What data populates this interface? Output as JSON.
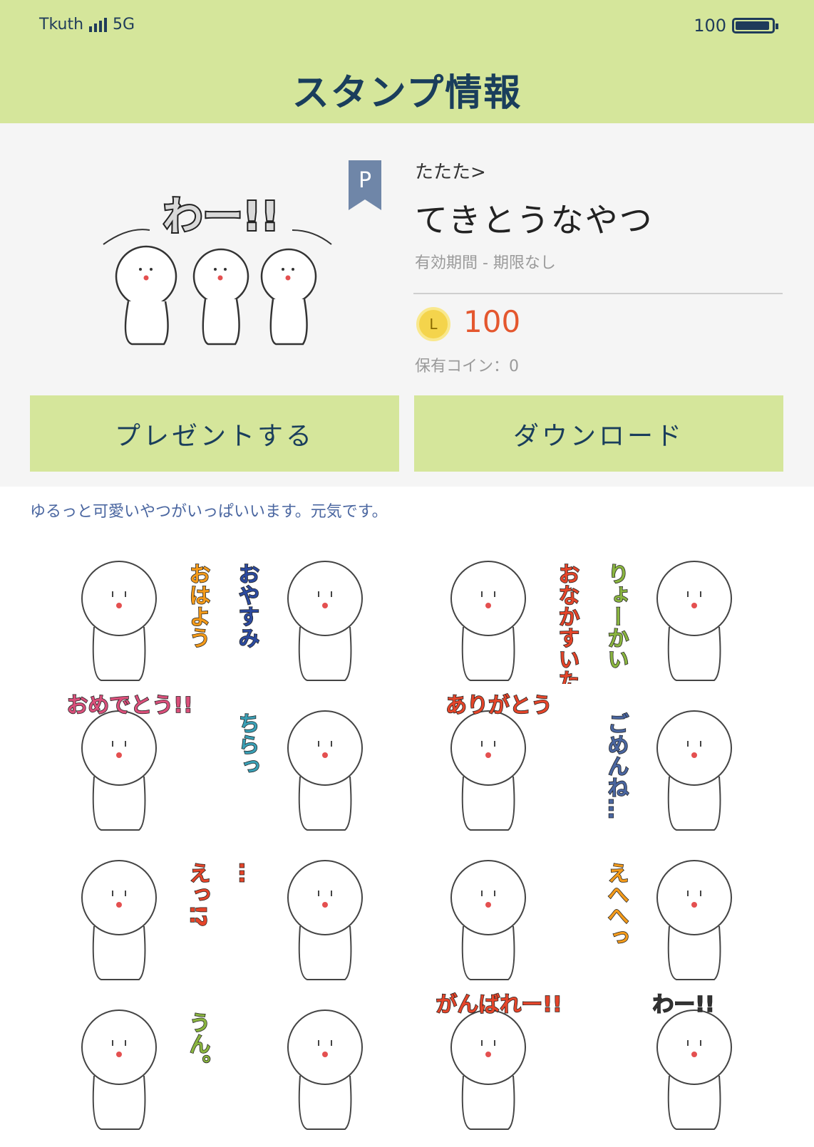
{
  "status_bar": {
    "carrier": "Tkuth",
    "network": "5G",
    "battery_level": "100",
    "battery_fraction": 0.95
  },
  "header": {
    "title": "スタンプ情報"
  },
  "pack": {
    "badge": "P",
    "author": "たたた>",
    "name": "てきとうなやつ",
    "validity": "有効期間 - 期限なし",
    "coin_symbol": "L",
    "price": "100",
    "owned_coins": "保有コイン：0",
    "description": "ゆるっと可愛いやつがいっぱいいます。元気です。"
  },
  "actions": {
    "present_label": "プレゼントする",
    "download_label": "ダウンロード"
  },
  "stickers": [
    {
      "caption": "おはよう",
      "color": "#f39a1a"
    },
    {
      "caption": "おやすみ",
      "color": "#2c4a9e"
    },
    {
      "caption": "おなかすいた",
      "color": "#e4452a"
    },
    {
      "caption": "りょーかい",
      "color": "#8ab540"
    },
    {
      "caption": "おめでとう!!",
      "color": "#d94f7a"
    },
    {
      "caption": "ちらっ",
      "color": "#3a9fb5"
    },
    {
      "caption": "ありがとう",
      "color": "#e4452a"
    },
    {
      "caption": "ごめんね…",
      "color": "#4a66a0"
    },
    {
      "caption": "えっ!?",
      "color": "#e4452a"
    },
    {
      "caption": "…",
      "color": "#e4452a"
    },
    {
      "caption": "",
      "color": "#333333"
    },
    {
      "caption": "えへへっ",
      "color": "#f39a1a"
    },
    {
      "caption": "うん。",
      "color": "#8ab540"
    },
    {
      "caption": "",
      "color": "#333333"
    },
    {
      "caption": "がんばれー!!",
      "color": "#e4452a"
    },
    {
      "caption": "わー!!",
      "color": "#333333"
    }
  ],
  "hero_caption": "わー!!"
}
